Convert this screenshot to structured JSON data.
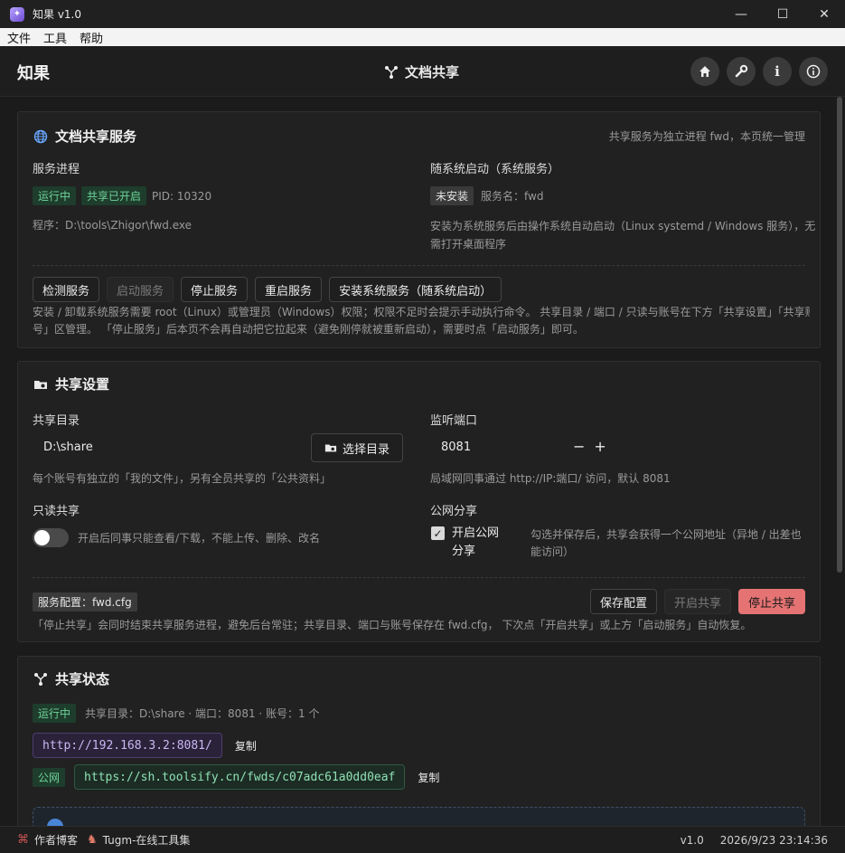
{
  "window": {
    "title": "知果 v1.0",
    "controls": [
      "—",
      "☐",
      "✕"
    ]
  },
  "menu": [
    "文件",
    "工具",
    "帮助"
  ],
  "header": {
    "brand": "知果",
    "page_title": "文档共享",
    "icons": [
      "home-icon",
      "wrench-icon",
      "info-icon",
      "about-icon"
    ]
  },
  "service": {
    "title": "文档共享服务",
    "note": "共享服务为独立进程 fwd，本页统一管理",
    "process_label": "服务进程",
    "status_running": "运行中",
    "status_shared": "共享已开启",
    "pid": "PID: 10320",
    "program": "程序：D:\\tools\\Zhigor\\fwd.exe",
    "autostart_label": "随系统启动（系统服务）",
    "autostart_status": "未安装",
    "service_name": "服务名：fwd",
    "autostart_desc_1": "安装为系统服务后由操作系统自动启动（Linux systemd / Windows 服务），无",
    "autostart_desc_2": "需打开桌面程序",
    "buttons": {
      "check": "检测服务",
      "start": "启动服务",
      "stop": "停止服务",
      "restart": "重启服务",
      "install": "安装系统服务（随系统启动）"
    },
    "help_1": "安装 / 卸载系统服务需要 root（Linux）或管理员（Windows）权限；权限不足时会提示手动执行命令。 共享目录 / 端口 / 只读与账号在下方「共享设置」「共享账",
    "help_2": "号」区管理。 「停止服务」后本页不会再自动把它拉起来（避免刚停就被重新启动），需要时点「启动服务」即可。"
  },
  "settings": {
    "title": "共享设置",
    "dir_label": "共享目录",
    "dir_value": "D:\\share",
    "choose_dir": "选择目录",
    "dir_hint": "每个账号有独立的「我的文件」，另有全员共享的「公共资料」",
    "port_label": "监听端口",
    "port_value": "8081",
    "port_hint": "局域网同事通过 http://IP:端口/ 访问，默认 8081",
    "readonly_label": "只读共享",
    "readonly_hint": "开启后同事只能查看/下载，不能上传、删除、改名",
    "readonly_on": false,
    "public_label": "公网分享",
    "public_checkbox_1": "开启公网",
    "public_checkbox_2": "分享",
    "public_checked": true,
    "public_hint_1": "勾选并保存后，共享会获得一个公网地址（异地 / 出差也",
    "public_hint_2": "能访问）",
    "config_tag": "服务配置：fwd.cfg",
    "save": "保存配置",
    "start_share": "开启共享",
    "stop_share": "停止共享",
    "footer_note": "「停止共享」会同时结束共享服务进程，避免后台常驻；共享目录、端口与账号保存在 fwd.cfg， 下次点「开启共享」或上方「启动服务」自动恢复。"
  },
  "status": {
    "title": "共享状态",
    "running": "运行中",
    "summary": "共享目录：D:\\share · 端口：8081 · 账号：1 个",
    "lan_url": "http://192.168.3.2:8081/",
    "copy": "复制",
    "public_tag": "公网",
    "public_url": "https://sh.toolsify.cn/fwds/c07adc61a0dd0eaf"
  },
  "footer": {
    "blog": "作者博客",
    "tools": "Tugm-在线工具集",
    "version": "v1.0",
    "datetime": "2026/9/23 23:14:36"
  }
}
